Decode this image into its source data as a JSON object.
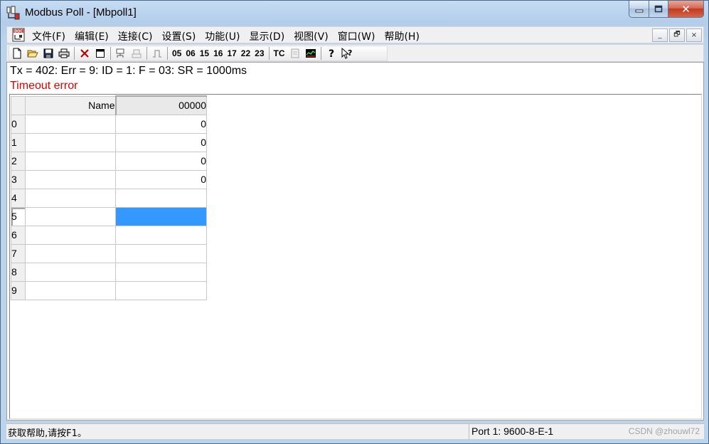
{
  "window": {
    "title": "Modbus Poll - [Mbpoll1]",
    "minimize": "—",
    "maximize": "☐",
    "close": "✕"
  },
  "menubar": {
    "items": [
      "文件(F)",
      "编辑(E)",
      "连接(C)",
      "设置(S)",
      "功能(U)",
      "显示(D)",
      "视图(V)",
      "窗口(W)",
      "帮助(H)"
    ],
    "mdi": {
      "minimize": "_",
      "restore": "🗗",
      "close": "×"
    }
  },
  "toolbar": {
    "function_codes": [
      "05",
      "06",
      "15",
      "16",
      "17",
      "22",
      "23"
    ],
    "tc_label": "TC"
  },
  "status": {
    "line1": "Tx = 402: Err = 9: ID = 1: F = 03: SR = 1000ms",
    "line2": "Timeout error",
    "error_color": "#e00000"
  },
  "grid": {
    "header_name": "Name",
    "header_address": "00000",
    "rows": [
      {
        "index": "0",
        "name": "",
        "value": "0"
      },
      {
        "index": "1",
        "name": "",
        "value": "0"
      },
      {
        "index": "2",
        "name": "",
        "value": "0"
      },
      {
        "index": "3",
        "name": "",
        "value": "0"
      },
      {
        "index": "4",
        "name": "",
        "value": ""
      },
      {
        "index": "5",
        "name": "",
        "value": ""
      },
      {
        "index": "6",
        "name": "",
        "value": ""
      },
      {
        "index": "7",
        "name": "",
        "value": ""
      },
      {
        "index": "8",
        "name": "",
        "value": ""
      },
      {
        "index": "9",
        "name": "",
        "value": ""
      }
    ],
    "selected_row": 5,
    "selection_color": "#3399ff"
  },
  "statusbar": {
    "help": "获取帮助,请按F1。",
    "port": "Port 1: 9600-8-E-1",
    "watermark": "CSDN @zhouwl72"
  }
}
